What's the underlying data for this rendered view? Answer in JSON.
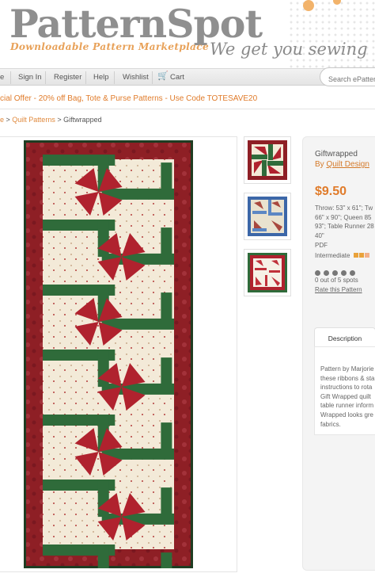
{
  "header": {
    "logo": "PatternSpot",
    "tagline": "Downloadable Pattern Marketplace",
    "slogan": "We get you sewing"
  },
  "nav": {
    "items": [
      "e",
      "Sign In",
      "Register",
      "Help",
      "Wishlist",
      "Cart"
    ],
    "search_placeholder": "Search ePattern"
  },
  "promo": "cial Offer - 20% off Bag, Tote & Purse Patterns - Use Code TOTESAVE20",
  "breadcrumb": {
    "home": "e",
    "category": "Quilt Patterns",
    "current": "Giftwrapped"
  },
  "product": {
    "title": "Giftwrapped",
    "by_label": "By",
    "designer": "Quilt Design",
    "price": "$9.50",
    "sizes": [
      "Throw: 53\" x 61\"; Tw",
      "66\" x 90\"; Queen 85",
      "93\"; Table Runner 28",
      "40\""
    ],
    "format": "PDF",
    "level": "Intermediate",
    "level_colors": [
      "#e9a23b",
      "#e9a23b",
      "#f2b08a"
    ],
    "spots": "0 out of 5 spots",
    "rate_link": "Rate this Pattern",
    "rating_dots": 5
  },
  "description": {
    "tab_label": "Description",
    "lines": [
      "Pattern by Marjorie",
      "these ribbons & sta",
      "instructions to rota",
      "Gift Wrapped quilt",
      "table runner inform",
      "Wrapped looks gre",
      "fabrics."
    ]
  },
  "images": {
    "main_alt": "Giftwrapped table runner quilt",
    "thumbnails": [
      "thumb-red-green",
      "thumb-blue",
      "thumb-red-white"
    ]
  },
  "colors": {
    "accent": "#e07b2a",
    "quilt_border": "#8e1f25",
    "quilt_green": "#2f6b3a",
    "quilt_red": "#b0222e",
    "quilt_cream": "#f3ead8"
  }
}
